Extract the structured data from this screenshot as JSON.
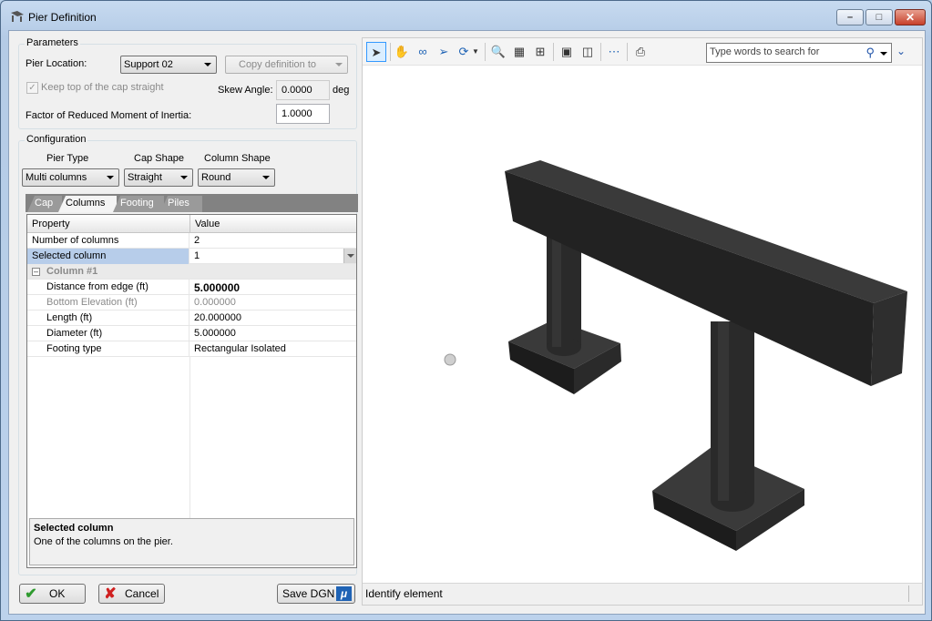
{
  "window": {
    "title": "Pier Definition",
    "min_icon": "minimize-icon",
    "max_icon": "maximize-icon",
    "close_icon": "close-icon"
  },
  "parameters": {
    "group_title": "Parameters",
    "pier_location_label": "Pier Location:",
    "pier_location_value": "Support 02",
    "copy_button": "Copy definition to",
    "keep_top_label": "Keep top of the cap straight",
    "keep_top_checked": true,
    "skew_label": "Skew Angle:",
    "skew_value": "0.0000",
    "skew_unit": "deg",
    "inertia_label": "Factor of Reduced Moment of Inertia:",
    "inertia_value": "1.0000"
  },
  "configuration": {
    "group_title": "Configuration",
    "pier_type_label": "Pier Type",
    "pier_type_value": "Multi columns",
    "cap_shape_label": "Cap Shape",
    "cap_shape_value": "Straight",
    "column_shape_label": "Column Shape",
    "column_shape_value": "Round"
  },
  "tabs": [
    {
      "label": "Cap",
      "active": false
    },
    {
      "label": "Columns",
      "active": true
    },
    {
      "label": "Footing",
      "active": false
    },
    {
      "label": "Piles",
      "active": false
    }
  ],
  "grid": {
    "header_property": "Property",
    "header_value": "Value",
    "rows": [
      {
        "property": "Number of columns",
        "value": "2"
      },
      {
        "property": "Selected column",
        "value": "1"
      },
      {
        "property": "Column #1",
        "value": ""
      },
      {
        "property": "Distance from edge (ft)",
        "value": "5.000000"
      },
      {
        "property": "Bottom Elevation (ft)",
        "value": "0.000000"
      },
      {
        "property": "Length (ft)",
        "value": "20.000000"
      },
      {
        "property": "Diameter (ft)",
        "value": "5.000000"
      },
      {
        "property": "Footing type",
        "value": "Rectangular Isolated"
      }
    ],
    "description_title": "Selected column",
    "description_text": "One of the columns on the pier."
  },
  "buttons": {
    "ok": "OK",
    "cancel": "Cancel",
    "save_dgn": "Save DGN"
  },
  "viewer": {
    "search_placeholder": "Type words to search for",
    "status": "Identify element",
    "tools": [
      "select-arrow-icon",
      "pan-hand-icon",
      "walk-icon",
      "fly-icon",
      "rotate-icon",
      "zoom-icon",
      "zoom-window-icon",
      "fit-view-icon",
      "view-icon",
      "camera-icon",
      "measure-icon",
      "print-icon"
    ]
  },
  "colors": {
    "accent": "#3399ff",
    "selection": "#b7cdea",
    "model": "#2a2a2a"
  }
}
